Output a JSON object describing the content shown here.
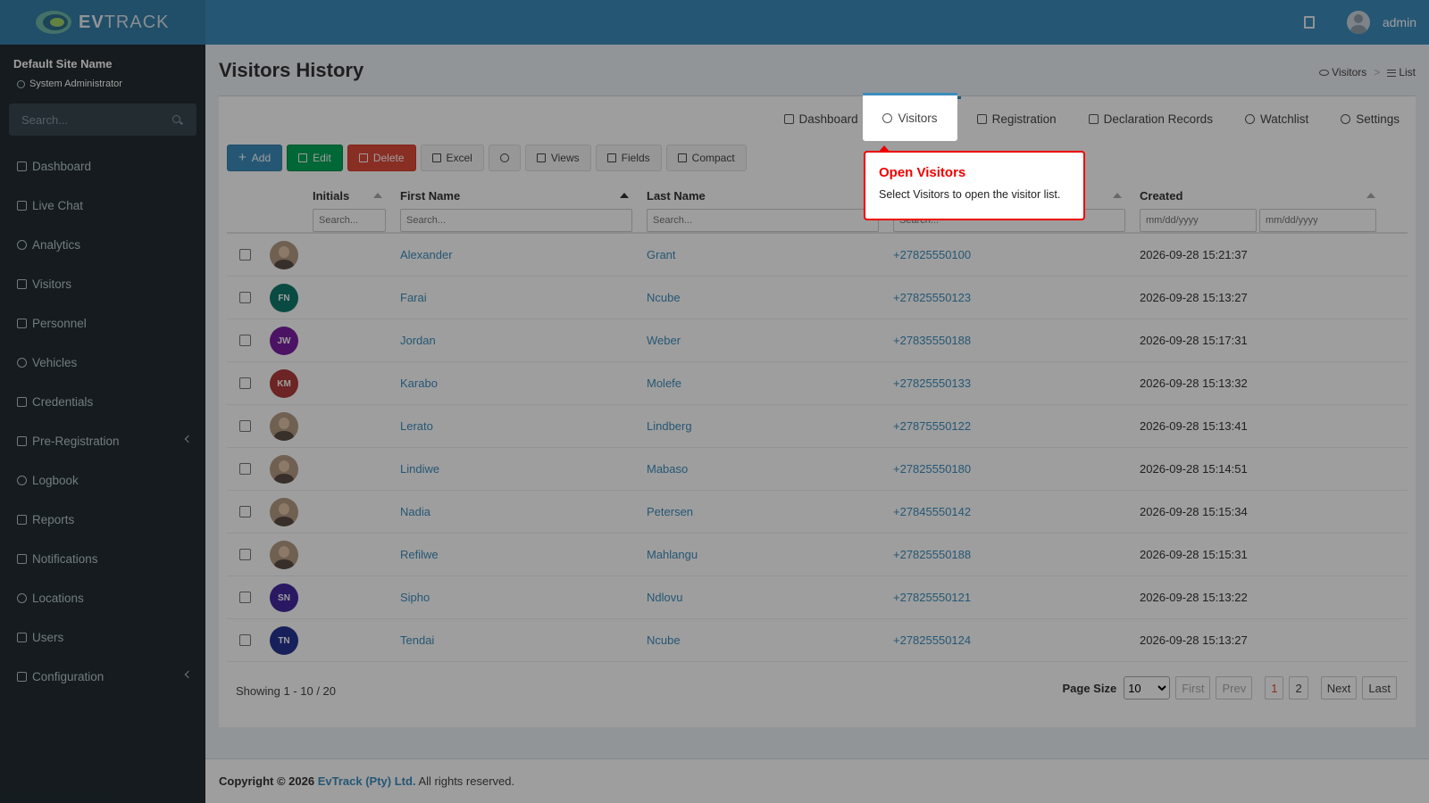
{
  "app": {
    "logo_text_bold": "EV",
    "logo_text": "TRACK",
    "user_name": "admin"
  },
  "sidebar": {
    "site_name": "Default Site Name",
    "role": "System Administrator",
    "search_placeholder": "Search...",
    "items": [
      {
        "label": "Dashboard",
        "icon": "dashboard-icon"
      },
      {
        "label": "Live Chat",
        "icon": "headset-icon"
      },
      {
        "label": "Analytics",
        "icon": "target-icon"
      },
      {
        "label": "Visitors",
        "icon": "eye-icon"
      },
      {
        "label": "Personnel",
        "icon": "users-icon"
      },
      {
        "label": "Vehicles",
        "icon": "car-icon"
      },
      {
        "label": "Credentials",
        "icon": "id-card-icon"
      },
      {
        "label": "Pre-Registration",
        "icon": "arrows-icon"
      },
      {
        "label": "Logbook",
        "icon": "book-icon"
      },
      {
        "label": "Reports",
        "icon": "chart-icon"
      },
      {
        "label": "Notifications",
        "icon": "chat-icon"
      },
      {
        "label": "Locations",
        "icon": "building-icon"
      },
      {
        "label": "Users",
        "icon": "user-icon"
      },
      {
        "label": "Configuration",
        "icon": "gear-icon"
      }
    ]
  },
  "page": {
    "title": "Visitors History",
    "breadcrumb": [
      "Visitors",
      "List"
    ]
  },
  "tabs": [
    {
      "label": "Dashboard",
      "icon": "walking-icon"
    },
    {
      "label": "Visitors",
      "icon": "eye-icon"
    },
    {
      "label": "Registration",
      "icon": "arrows-icon"
    },
    {
      "label": "Declaration Records",
      "icon": "edit-icon"
    },
    {
      "label": "Watchlist",
      "icon": "ban-icon"
    },
    {
      "label": "Settings",
      "icon": "gear-icon"
    }
  ],
  "toolbar": {
    "add": "Add",
    "edit": "Edit",
    "delete": "Delete",
    "excel": "Excel",
    "views": "Views",
    "fields": "Fields",
    "compact": "Compact"
  },
  "table": {
    "columns": {
      "initials": "Initials",
      "first_name": "First Name",
      "last_name": "Last Name",
      "created": "Created"
    },
    "filter_placeholder": "Search...",
    "date_placeholder": "mm/dd/yyyy",
    "rows": [
      {
        "initials": "",
        "first": "Alexander",
        "last": "Grant",
        "phone": "+27825550100",
        "created": "2026-09-28 15:21:37",
        "avatar_color": "photo"
      },
      {
        "initials": "FN",
        "first": "Farai",
        "last": "Ncube",
        "phone": "+27825550123",
        "created": "2026-09-28 15:13:27",
        "avatar_color": "#0f7a6b"
      },
      {
        "initials": "JW",
        "first": "Jordan",
        "last": "Weber",
        "phone": "+27835550188",
        "created": "2026-09-28 15:17:31",
        "avatar_color": "#7b1fa2"
      },
      {
        "initials": "KM",
        "first": "Karabo",
        "last": "Molefe",
        "phone": "+27825550133",
        "created": "2026-09-28 15:13:32",
        "avatar_color": "#b03a3a"
      },
      {
        "initials": "",
        "first": "Lerato",
        "last": "Lindberg",
        "phone": "+27875550122",
        "created": "2026-09-28 15:13:41",
        "avatar_color": "photo"
      },
      {
        "initials": "",
        "first": "Lindiwe",
        "last": "Mabaso",
        "phone": "+27825550180",
        "created": "2026-09-28 15:14:51",
        "avatar_color": "photo"
      },
      {
        "initials": "",
        "first": "Nadia",
        "last": "Petersen",
        "phone": "+27845550142",
        "created": "2026-09-28 15:15:34",
        "avatar_color": "photo"
      },
      {
        "initials": "",
        "first": "Refilwe",
        "last": "Mahlangu",
        "phone": "+27825550188",
        "created": "2026-09-28 15:15:31",
        "avatar_color": "photo"
      },
      {
        "initials": "SN",
        "first": "Sipho",
        "last": "Ndlovu",
        "phone": "+27825550121",
        "created": "2026-09-28 15:13:22",
        "avatar_color": "#4527a0"
      },
      {
        "initials": "TN",
        "first": "Tendai",
        "last": "Ncube",
        "phone": "+27825550124",
        "created": "2026-09-28 15:13:27",
        "avatar_color": "#283593"
      }
    ]
  },
  "pagination": {
    "showing": "Showing 1 - 10 / 20",
    "page_size_label": "Page Size",
    "page_size": "10",
    "first": "First",
    "prev": "Prev",
    "pages": [
      "1",
      "2"
    ],
    "next": "Next",
    "last": "Last"
  },
  "footer": {
    "prefix": "Copyright © 2026",
    "company": "EvTrack (Pty) Ltd.",
    "suffix": "All rights reserved."
  },
  "tooltip": {
    "title": "Open Visitors",
    "body": "Select Visitors to open the visitor list."
  }
}
